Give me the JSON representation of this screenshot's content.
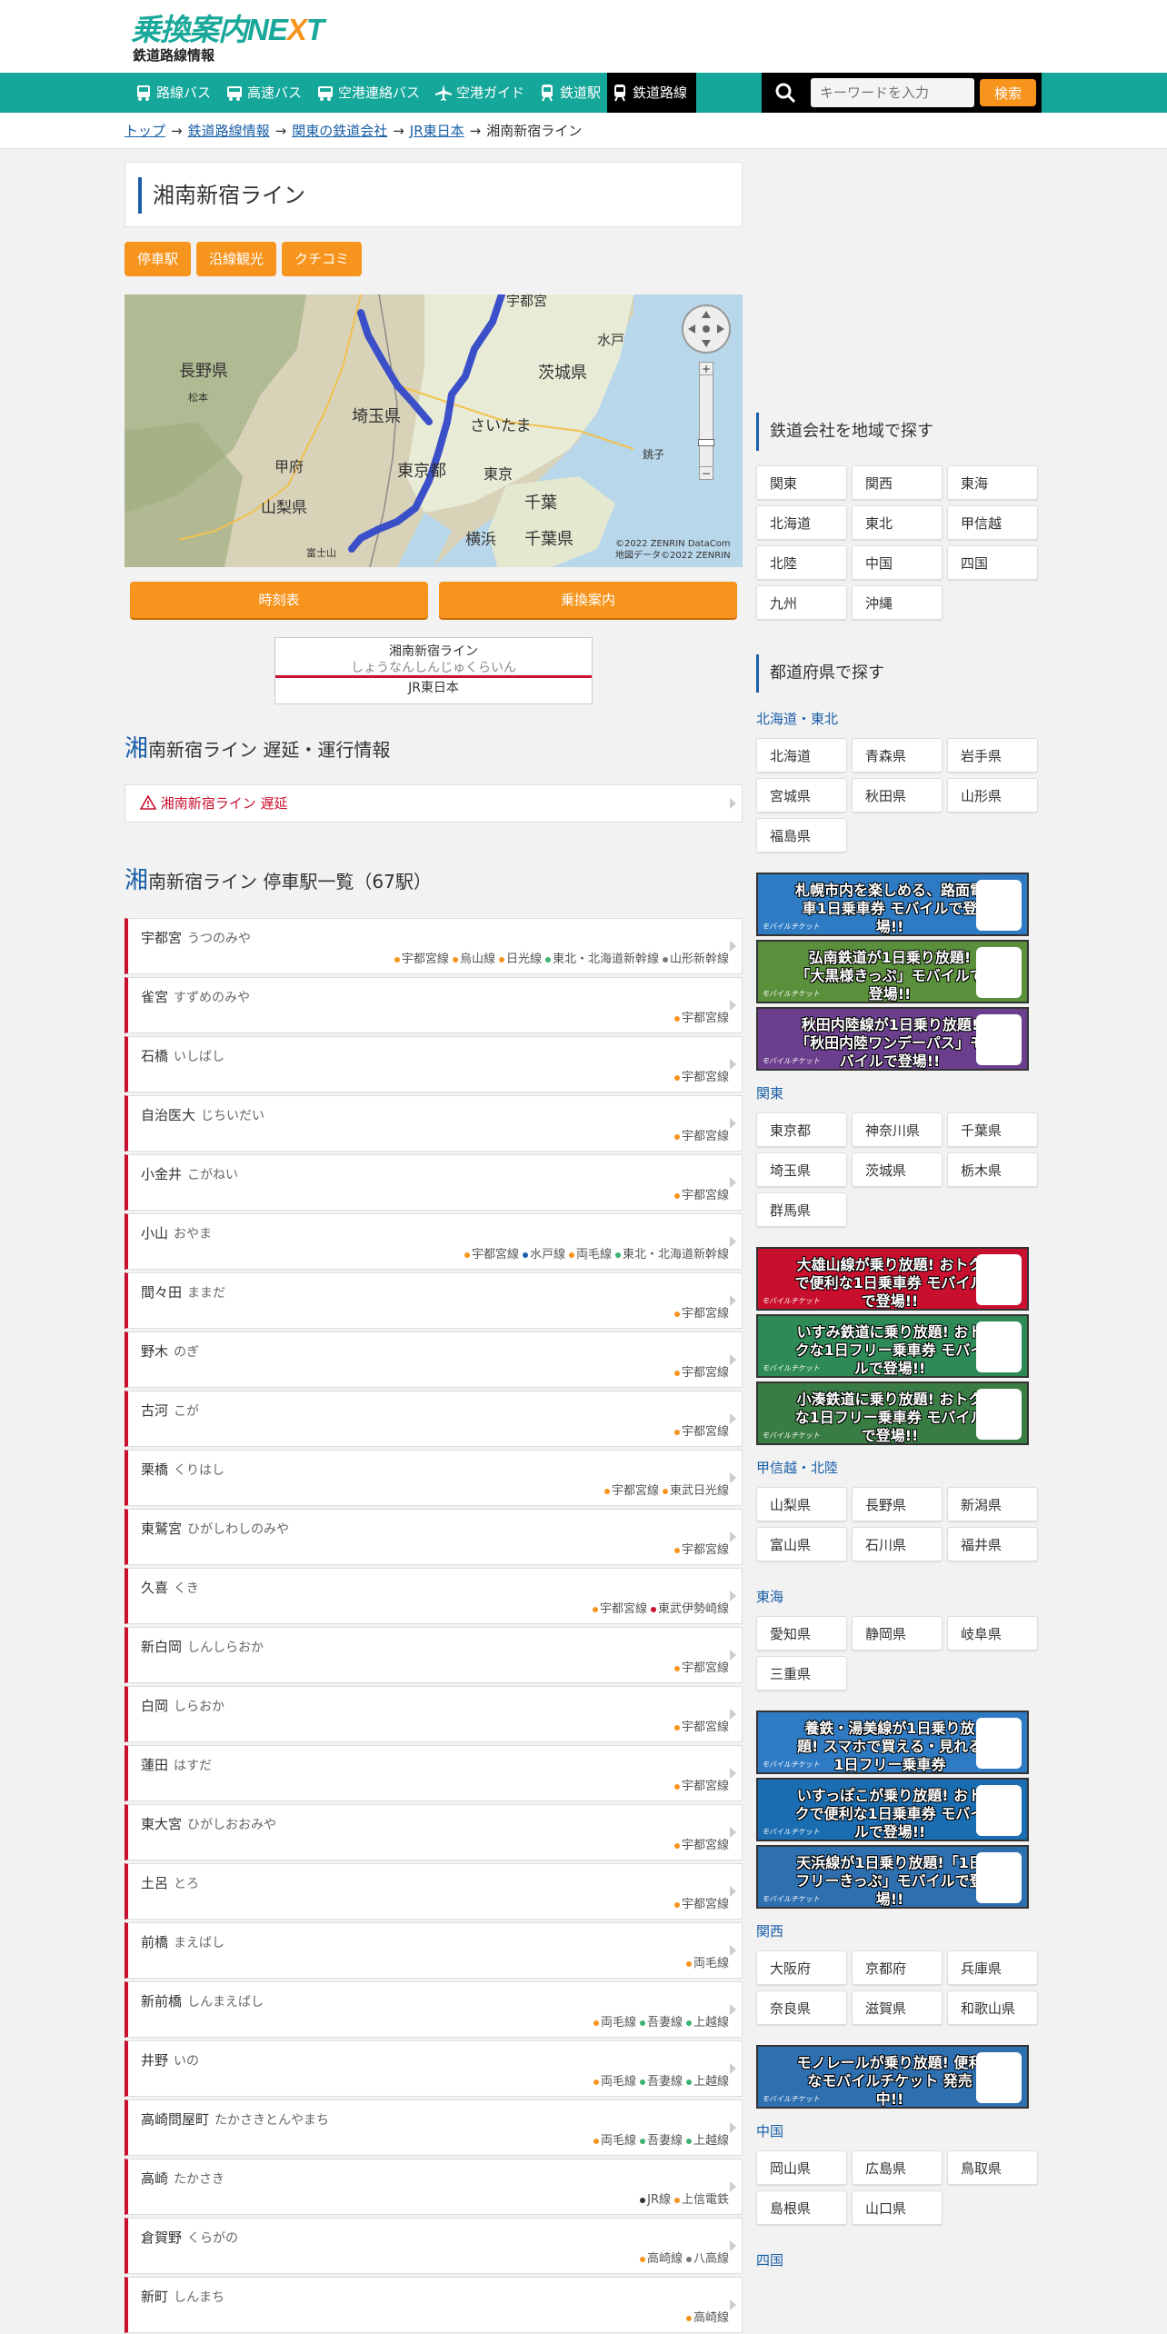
{
  "header": {
    "logo_main": "乗換案内",
    "logo_next_a": "NE",
    "logo_next_x": "X",
    "logo_next_t": "T",
    "subtitle": "鉄道路線情報"
  },
  "nav": {
    "items": [
      {
        "label": "路線バス"
      },
      {
        "label": "高速バス"
      },
      {
        "label": "空港連絡バス"
      },
      {
        "label": "空港ガイド"
      },
      {
        "label": "鉄道駅"
      },
      {
        "label": "鉄道路線"
      }
    ],
    "search_placeholder": "キーワードを入力",
    "search_button": "検索"
  },
  "breadcrumb": {
    "items": [
      "トップ",
      "鉄道路線情報",
      "関東の鉄道会社",
      "JR東日本"
    ],
    "current": "湘南新宿ライン",
    "sep": "→"
  },
  "page": {
    "title": "湘南新宿ライン",
    "tags": [
      "停車駅",
      "沿線観光",
      "クチコミ"
    ],
    "timetable_button": "時刻表",
    "transfer_button": "乗換案内"
  },
  "map": {
    "labels": [
      "長野県",
      "宇都宮",
      "水戸",
      "茨城県",
      "埼玉県",
      "さいたま",
      "甲府",
      "東京都",
      "東京",
      "千葉",
      "山梨県",
      "千葉県",
      "横浜",
      "銚子",
      "松本",
      "富士山"
    ],
    "copyright1": "©2022 ZENRIN DataCom",
    "copyright2": "地図データ©2022 ZENRIN"
  },
  "linecard": {
    "name": "湘南新宿ライン",
    "kana": "しょうなんしんじゅくらいん",
    "company": "JR東日本"
  },
  "delay": {
    "heading_first": "湘",
    "heading_rest": "南新宿ライン 遅延・運行情報",
    "item": "湘南新宿ライン 遅延"
  },
  "station_list": {
    "heading_first": "湘",
    "heading_rest": "南新宿ライン 停車駅一覧（67駅）",
    "stations": [
      {
        "name": "宇都宮",
        "kana": "うつのみや",
        "lines": [
          {
            "n": "宇都宮線",
            "c": "#f7941d"
          },
          {
            "n": "烏山線",
            "c": "#f7941d"
          },
          {
            "n": "日光線",
            "c": "#f7941d"
          },
          {
            "n": "東北・北海道新幹線",
            "c": "#3cb371"
          },
          {
            "n": "山形新幹線",
            "c": "#777"
          }
        ]
      },
      {
        "name": "雀宮",
        "kana": "すずめのみや",
        "lines": [
          {
            "n": "宇都宮線",
            "c": "#f7941d"
          }
        ]
      },
      {
        "name": "石橋",
        "kana": "いしばし",
        "lines": [
          {
            "n": "宇都宮線",
            "c": "#f7941d"
          }
        ]
      },
      {
        "name": "自治医大",
        "kana": "じちいだい",
        "lines": [
          {
            "n": "宇都宮線",
            "c": "#f7941d"
          }
        ]
      },
      {
        "name": "小金井",
        "kana": "こがねい",
        "lines": [
          {
            "n": "宇都宮線",
            "c": "#f7941d"
          }
        ]
      },
      {
        "name": "小山",
        "kana": "おやま",
        "lines": [
          {
            "n": "宇都宮線",
            "c": "#f7941d"
          },
          {
            "n": "水戸線",
            "c": "#1a5fa8"
          },
          {
            "n": "両毛線",
            "c": "#f7941d"
          },
          {
            "n": "東北・北海道新幹線",
            "c": "#3cb371"
          }
        ]
      },
      {
        "name": "間々田",
        "kana": "ままだ",
        "lines": [
          {
            "n": "宇都宮線",
            "c": "#f7941d"
          }
        ]
      },
      {
        "name": "野木",
        "kana": "のぎ",
        "lines": [
          {
            "n": "宇都宮線",
            "c": "#f7941d"
          }
        ]
      },
      {
        "name": "古河",
        "kana": "こが",
        "lines": [
          {
            "n": "宇都宮線",
            "c": "#f7941d"
          }
        ]
      },
      {
        "name": "栗橋",
        "kana": "くりはし",
        "lines": [
          {
            "n": "宇都宮線",
            "c": "#f7941d"
          },
          {
            "n": "東武日光線",
            "c": "#f7941d"
          }
        ]
      },
      {
        "name": "東鷲宮",
        "kana": "ひがしわしのみや",
        "lines": [
          {
            "n": "宇都宮線",
            "c": "#f7941d"
          }
        ]
      },
      {
        "name": "久喜",
        "kana": "くき",
        "lines": [
          {
            "n": "宇都宮線",
            "c": "#f7941d"
          },
          {
            "n": "東武伊勢崎線",
            "c": "#c8102e"
          }
        ]
      },
      {
        "name": "新白岡",
        "kana": "しんしらおか",
        "lines": [
          {
            "n": "宇都宮線",
            "c": "#f7941d"
          }
        ]
      },
      {
        "name": "白岡",
        "kana": "しらおか",
        "lines": [
          {
            "n": "宇都宮線",
            "c": "#f7941d"
          }
        ]
      },
      {
        "name": "蓮田",
        "kana": "はすだ",
        "lines": [
          {
            "n": "宇都宮線",
            "c": "#f7941d"
          }
        ]
      },
      {
        "name": "東大宮",
        "kana": "ひがしおおみや",
        "lines": [
          {
            "n": "宇都宮線",
            "c": "#f7941d"
          }
        ]
      },
      {
        "name": "土呂",
        "kana": "とろ",
        "lines": [
          {
            "n": "宇都宮線",
            "c": "#f7941d"
          }
        ]
      },
      {
        "name": "前橋",
        "kana": "まえばし",
        "lines": [
          {
            "n": "両毛線",
            "c": "#f7941d"
          }
        ]
      },
      {
        "name": "新前橋",
        "kana": "しんまえばし",
        "lines": [
          {
            "n": "両毛線",
            "c": "#f7941d"
          },
          {
            "n": "吾妻線",
            "c": "#3cb371"
          },
          {
            "n": "上越線",
            "c": "#3cb371"
          }
        ]
      },
      {
        "name": "井野",
        "kana": "いの",
        "lines": [
          {
            "n": "両毛線",
            "c": "#f7941d"
          },
          {
            "n": "吾妻線",
            "c": "#3cb371"
          },
          {
            "n": "上越線",
            "c": "#3cb371"
          }
        ]
      },
      {
        "name": "高崎問屋町",
        "kana": "たかさきとんやまち",
        "lines": [
          {
            "n": "両毛線",
            "c": "#f7941d"
          },
          {
            "n": "吾妻線",
            "c": "#3cb371"
          },
          {
            "n": "上越線",
            "c": "#3cb371"
          }
        ]
      },
      {
        "name": "高崎",
        "kana": "たかさき",
        "lines": [
          {
            "n": "JR線",
            "c": "#333"
          },
          {
            "n": "上信電鉄",
            "c": "#f7941d"
          }
        ]
      },
      {
        "name": "倉賀野",
        "kana": "くらがの",
        "lines": [
          {
            "n": "高崎線",
            "c": "#f7941d"
          },
          {
            "n": "八高線",
            "c": "#777"
          }
        ]
      },
      {
        "name": "新町",
        "kana": "しんまち",
        "lines": [
          {
            "n": "高崎線",
            "c": "#f7941d"
          }
        ]
      }
    ]
  },
  "sidebar": {
    "company_head": "鉄道会社を地域で探す",
    "company_regions": [
      "関東",
      "関西",
      "東海",
      "北海道",
      "東北",
      "甲信越",
      "北陸",
      "中国",
      "四国",
      "九州",
      "沖縄"
    ],
    "pref_head": "都道府県で探す",
    "groups": [
      {
        "name": "北海道・東北",
        "prefs": [
          "北海道",
          "青森県",
          "岩手県",
          "宮城県",
          "秋田県",
          "山形県",
          "福島県"
        ]
      },
      {
        "name": "関東",
        "prefs": [
          "東京都",
          "神奈川県",
          "千葉県",
          "埼玉県",
          "茨城県",
          "栃木県",
          "群馬県"
        ]
      },
      {
        "name": "甲信越・北陸",
        "prefs": [
          "山梨県",
          "長野県",
          "新潟県",
          "富山県",
          "石川県",
          "福井県"
        ]
      },
      {
        "name": "東海",
        "prefs": [
          "愛知県",
          "静岡県",
          "岐阜県",
          "三重県"
        ]
      },
      {
        "name": "関西",
        "prefs": [
          "大阪府",
          "京都府",
          "兵庫県",
          "奈良県",
          "滋賀県",
          "和歌山県"
        ]
      },
      {
        "name": "中国",
        "prefs": [
          "岡山県",
          "広島県",
          "鳥取県",
          "島根県",
          "山口県"
        ]
      },
      {
        "name": "四国",
        "prefs": []
      }
    ],
    "banners_a": [
      {
        "text": "札幌市内を楽しめる、路面電車1日乗車券 モバイルで登場!!",
        "color": "#2e7bc4"
      },
      {
        "text": "弘南鉄道が1日乗り放題!「大黒様きっぷ」モバイルで登場!!",
        "color": "#5a8f3c"
      },
      {
        "text": "秋田内陸線が1日乗り放題!「秋田内陸ワンデーパス」モバイルで登場!!",
        "color": "#6b3f8e"
      }
    ],
    "banners_b": [
      {
        "text": "大雄山線が乗り放題! おトクで便利な1日乗車券 モバイルで登場!!",
        "color": "#c8102e"
      },
      {
        "text": "いすみ鉄道に乗り放題! おトクな1日フリー乗車券 モバイルで登場!!",
        "color": "#2e8b57"
      },
      {
        "text": "小湊鉄道に乗り放題! おトクな1日フリー乗車券 モバイルで登場!!",
        "color": "#3a7d44"
      }
    ],
    "banners_c": [
      {
        "text": "養鉄・湯美線が1日乗り放題! スマホで買える・見れる 1日フリー乗車券",
        "color": "#2e7bc4"
      },
      {
        "text": "いすっぽこが乗り放題! おトクで便利な1日乗車券 モバイルで登場!!",
        "color": "#1a6db0"
      },
      {
        "text": "天浜線が1日乗り放題!「1日フリーきっぷ」モバイルで登場!!",
        "color": "#2e6fb0"
      }
    ],
    "banners_d": [
      {
        "text": "モノレールが乗り放題! 便利なモバイルチケット 発売中!!",
        "color": "#2e6fb0"
      }
    ],
    "banner_brand": "モバイルチケット"
  }
}
